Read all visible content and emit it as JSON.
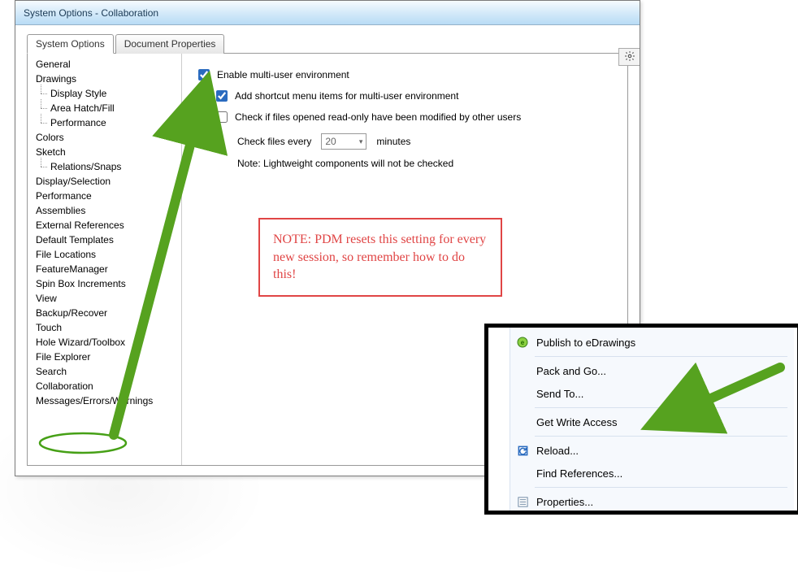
{
  "window": {
    "title": "System Options - Collaboration"
  },
  "tabs": {
    "system_options": "System Options",
    "document_properties": "Document Properties"
  },
  "tree": {
    "items": [
      "General",
      "Drawings",
      "Display Style",
      "Area Hatch/Fill",
      "Performance",
      "Colors",
      "Sketch",
      "Relations/Snaps",
      "Display/Selection",
      "Performance",
      "Assemblies",
      "External References",
      "Default Templates",
      "File Locations",
      "FeatureManager",
      "Spin Box Increments",
      "View",
      "Backup/Recover",
      "Touch",
      "Hole Wizard/Toolbox",
      "File Explorer",
      "Search",
      "Collaboration",
      "Messages/Errors/Warnings"
    ]
  },
  "options": {
    "enable_multi_user": "Enable multi-user environment",
    "add_shortcut": "Add shortcut menu items for multi-user environment",
    "check_readonly": "Check if files opened read-only have been modified by other users",
    "check_every_label": "Check files every",
    "check_every_value": "20",
    "check_every_units": "minutes",
    "lightweight_note": "Note: Lightweight components will not be checked"
  },
  "note_box": "NOTE: PDM resets this setting for every new session, so remember how to do this!",
  "context_menu": {
    "items": [
      {
        "label": "Publish to eDrawings",
        "icon": "edrawings-icon"
      },
      {
        "label": "Pack and Go...",
        "icon": ""
      },
      {
        "label": "Send To...",
        "icon": ""
      },
      {
        "label": "Get Write Access",
        "icon": ""
      },
      {
        "label": "Reload...",
        "icon": "reload-icon"
      },
      {
        "label": "Find References...",
        "icon": ""
      },
      {
        "label": "Properties...",
        "icon": "properties-icon"
      }
    ]
  }
}
